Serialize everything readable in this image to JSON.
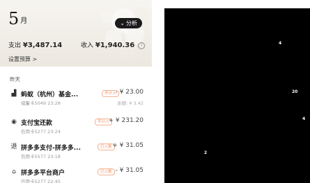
{
  "header": {
    "month_number": "5",
    "month_unit": "月",
    "analyze_label": "分析",
    "expense_label": "支出",
    "expense_amount": "¥3,487.14",
    "income_label": "收入",
    "income_amount": "¥1,940.36",
    "budget_label": "设置预算 >"
  },
  "list": {
    "day_label": "昨天",
    "transactions": [
      {
        "icon": "fund-icon",
        "title": "蚂蚁（杭州）基金...",
        "sub": "储蓄卡5049 23:28",
        "tag": "不计入",
        "amount": "- ¥ 23.00",
        "balance": "余额: ¥ 3.42"
      },
      {
        "icon": "repay-icon",
        "title": "支付宝还款",
        "sub": "信用卡5277 23:24",
        "tag": "不计入",
        "amount": "+ ¥ 231.20",
        "balance": ""
      },
      {
        "icon": "refund-icon",
        "title": "拼多多支付-拼多多...",
        "sub": "信用卡5577 23:18",
        "tag": "已入账",
        "amount": "+ ¥ 31.05",
        "balance": ""
      },
      {
        "icon": "shopping-bag-icon",
        "title": "拼多多平台商户",
        "sub": "信用卡5277 22:45",
        "tag": "已入账",
        "amount": "- ¥ 31.05",
        "balance": ""
      }
    ]
  },
  "overlay": {
    "marks": [
      "4",
      "20",
      "4",
      "2"
    ]
  }
}
